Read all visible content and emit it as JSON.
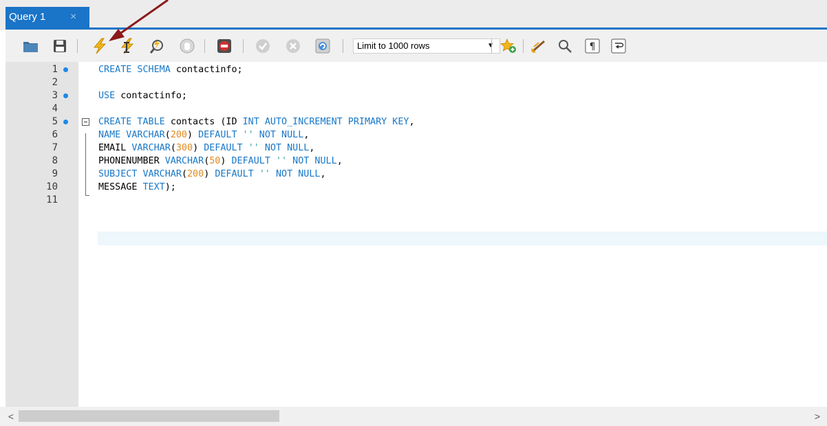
{
  "tab": {
    "label": "Query 1",
    "close_glyph": "×"
  },
  "toolbar": {
    "buttons": [
      {
        "name": "open-sql-file-button",
        "icon": "folder-icon"
      },
      {
        "name": "save-script-button",
        "icon": "floppy-disk-icon"
      },
      {
        "name": "execute-all-button",
        "icon": "lightning-bolt-icon"
      },
      {
        "name": "execute-current-statement-button",
        "icon": "lightning-cursor-icon"
      },
      {
        "name": "explain-button",
        "icon": "magnifier-icon"
      },
      {
        "name": "stop-button",
        "icon": "stop-hand-icon"
      },
      {
        "name": "toggle-stop-on-error-button",
        "icon": "error-stop-icon"
      },
      {
        "name": "commit-button",
        "icon": "check-circle-icon"
      },
      {
        "name": "rollback-button",
        "icon": "x-circle-icon"
      },
      {
        "name": "toggle-autocommit-button",
        "icon": "autocommit-icon"
      },
      {
        "name": "add-snippet-button",
        "icon": "star-plus-icon"
      },
      {
        "name": "beautify-button",
        "icon": "brush-icon"
      },
      {
        "name": "find-button",
        "icon": "search-icon"
      },
      {
        "name": "invisible-chars-button",
        "icon": "pilcrow-icon"
      },
      {
        "name": "word-wrap-button",
        "icon": "wrap-icon"
      }
    ],
    "limit": {
      "label": "Limit to 1000 rows",
      "arrow": "▼"
    }
  },
  "editor": {
    "line_numbers": [
      "1",
      "2",
      "3",
      "4",
      "5",
      "6",
      "7",
      "8",
      "9",
      "10",
      "11"
    ],
    "marked_lines": [
      1,
      3,
      5
    ],
    "lines": [
      [
        {
          "t": "kw",
          "v": "CREATE SCHEMA "
        },
        {
          "t": "id",
          "v": "contactinfo;"
        }
      ],
      [],
      [
        {
          "t": "kw",
          "v": "USE "
        },
        {
          "t": "id",
          "v": "contactinfo;"
        }
      ],
      [],
      [
        {
          "t": "kw",
          "v": "CREATE TABLE "
        },
        {
          "t": "id",
          "v": "contacts (ID "
        },
        {
          "t": "kw",
          "v": "INT AUTO_INCREMENT PRIMARY KEY"
        },
        {
          "t": "id",
          "v": ","
        }
      ],
      [
        {
          "t": "kw",
          "v": "NAME VARCHAR"
        },
        {
          "t": "id",
          "v": "("
        },
        {
          "t": "num",
          "v": "200"
        },
        {
          "t": "id",
          "v": ") "
        },
        {
          "t": "kw",
          "v": "DEFAULT "
        },
        {
          "t": "str",
          "v": "''"
        },
        {
          "t": "kw",
          "v": " NOT NULL"
        },
        {
          "t": "id",
          "v": ","
        }
      ],
      [
        {
          "t": "id",
          "v": "EMAIL "
        },
        {
          "t": "kw",
          "v": "VARCHAR"
        },
        {
          "t": "id",
          "v": "("
        },
        {
          "t": "num",
          "v": "300"
        },
        {
          "t": "id",
          "v": ") "
        },
        {
          "t": "kw",
          "v": "DEFAULT "
        },
        {
          "t": "str",
          "v": "''"
        },
        {
          "t": "kw",
          "v": " NOT NULL"
        },
        {
          "t": "id",
          "v": ","
        }
      ],
      [
        {
          "t": "id",
          "v": "PHONENUMBER "
        },
        {
          "t": "kw",
          "v": "VARCHAR"
        },
        {
          "t": "id",
          "v": "("
        },
        {
          "t": "num",
          "v": "50"
        },
        {
          "t": "id",
          "v": ") "
        },
        {
          "t": "kw",
          "v": "DEFAULT "
        },
        {
          "t": "str",
          "v": "''"
        },
        {
          "t": "kw",
          "v": " NOT NULL"
        },
        {
          "t": "id",
          "v": ","
        }
      ],
      [
        {
          "t": "kw",
          "v": "SUBJECT VARCHAR"
        },
        {
          "t": "id",
          "v": "("
        },
        {
          "t": "num",
          "v": "200"
        },
        {
          "t": "id",
          "v": ") "
        },
        {
          "t": "kw",
          "v": "DEFAULT "
        },
        {
          "t": "str",
          "v": "''"
        },
        {
          "t": "kw",
          "v": " NOT NULL"
        },
        {
          "t": "id",
          "v": ","
        }
      ],
      [
        {
          "t": "id",
          "v": "MESSAGE "
        },
        {
          "t": "kw",
          "v": "TEXT"
        },
        {
          "t": "id",
          "v": ");"
        }
      ],
      []
    ]
  },
  "scrollbar": {
    "left_glyph": "<",
    "right_glyph": ">"
  },
  "colors": {
    "tab_accent": "#1a74c7",
    "keyword": "#1878c8",
    "number": "#e08a20",
    "string": "#3aa0a0",
    "line_marker": "#1e88e5",
    "annotation_arrow": "#8b1a1a"
  }
}
